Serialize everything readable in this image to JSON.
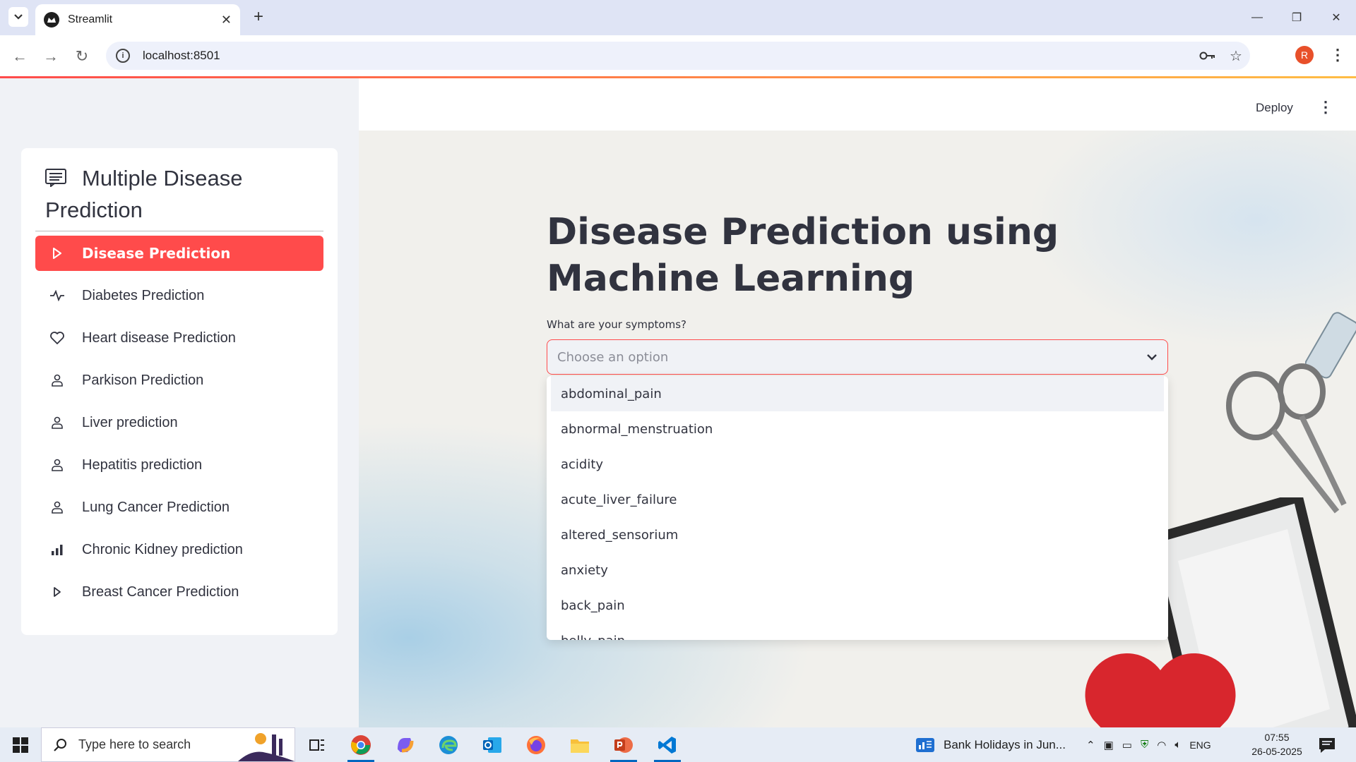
{
  "browser": {
    "tab_title": "Streamlit",
    "url": "localhost:8501",
    "profile_initial": "R"
  },
  "app": {
    "deploy_label": "Deploy",
    "menu": {
      "title": "Multiple Disease Prediction",
      "items": [
        {
          "label": "Disease Prediction",
          "icon": "play-icon",
          "active": true
        },
        {
          "label": "Diabetes Prediction",
          "icon": "activity-icon",
          "active": false
        },
        {
          "label": "Heart disease Prediction",
          "icon": "heart-icon",
          "active": false
        },
        {
          "label": "Parkison Prediction",
          "icon": "person-icon",
          "active": false
        },
        {
          "label": "Liver prediction",
          "icon": "person-icon",
          "active": false
        },
        {
          "label": "Hepatitis prediction",
          "icon": "person-icon",
          "active": false
        },
        {
          "label": "Lung Cancer Prediction",
          "icon": "person-icon",
          "active": false
        },
        {
          "label": "Chronic Kidney prediction",
          "icon": "bar-chart-icon",
          "active": false
        },
        {
          "label": "Breast Cancer Prediction",
          "icon": "play-icon",
          "active": false
        }
      ]
    },
    "main": {
      "title": "Disease Prediction using Machine Learning",
      "symptoms_label": "What are your symptoms?",
      "symptoms_placeholder": "Choose an option",
      "options": [
        "abdominal_pain",
        "abnormal_menstruation",
        "acidity",
        "acute_liver_failure",
        "altered_sensorium",
        "anxiety",
        "back_pain",
        "belly_pain"
      ]
    }
  },
  "taskbar": {
    "search_placeholder": "Type here to search",
    "news": "Bank Holidays in Jun...",
    "language": "ENG",
    "time": "07:55",
    "date": "26-05-2025"
  },
  "colors": {
    "accent": "#ff4b4b",
    "text": "#31333f",
    "sidebar_bg": "#f0f2f6"
  }
}
